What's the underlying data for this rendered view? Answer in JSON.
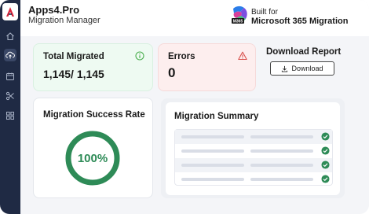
{
  "header": {
    "brand_title": "Apps4.Pro",
    "brand_subtitle": "Migration Manager",
    "built_for_line1": "Built for",
    "built_for_line2": "Microsoft 365 Migration",
    "ms_logo_badge": "M365"
  },
  "sidebar": {
    "items": [
      {
        "icon": "home-icon"
      },
      {
        "icon": "cloud-upload-icon",
        "active": true
      },
      {
        "icon": "calendar-icon"
      },
      {
        "icon": "scissors-icon"
      },
      {
        "icon": "grid-icon"
      }
    ]
  },
  "cards": {
    "total_migrated": {
      "label": "Total Migrated",
      "value": "1,145/ 1,145",
      "icon": "info-icon"
    },
    "errors": {
      "label": "Errors",
      "value": "0",
      "icon": "warning-icon"
    },
    "download": {
      "title": "Download Report",
      "button_label": "Download",
      "icon": "download-icon"
    }
  },
  "success_rate": {
    "label": "Migration Success Rate",
    "value_text": "100%",
    "progress": 1.0,
    "color": "#2e8b57"
  },
  "summary": {
    "label": "Migration Summary",
    "row_count": 4,
    "row_status": [
      "complete",
      "complete",
      "complete",
      "complete"
    ]
  },
  "colors": {
    "sidebar_bg": "#1f2a44",
    "success_green": "#2e8b57",
    "error_red": "#d9534f",
    "info_green": "#4caf50"
  }
}
